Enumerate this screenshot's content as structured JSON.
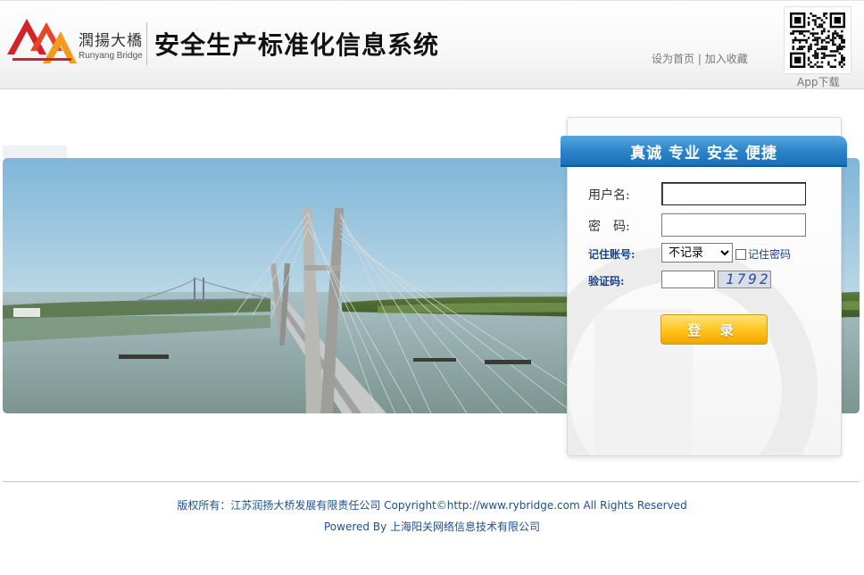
{
  "header": {
    "logo_cn": "潤揚大橋",
    "logo_en": "Runyang Bridge",
    "site_title": "安全生产标准化信息系统",
    "link_set_home": "设为首页",
    "link_separator": "|",
    "link_bookmark": "加入收藏",
    "app_download": "App下载"
  },
  "colors": {
    "logo_red": "#d3232a",
    "logo_orange": "#f29c1f",
    "slogan_blue": "#2b83c9",
    "login_button": "#ffc31a",
    "footer_text": "#1e4f8f"
  },
  "login": {
    "slogan": "真诚 专业 安全 便捷",
    "username_label": "用户名:",
    "username_value": "",
    "password_label": "密　码:",
    "password_value": "",
    "remember_account_label": "记住账号:",
    "remember_options": [
      "不记录"
    ],
    "remember_selected": "不记录",
    "remember_password_label": "记住密码",
    "captcha_label": "验证码:",
    "captcha_value": "",
    "captcha_code": "1792",
    "login_button": "登 录"
  },
  "footer": {
    "line1": "版权所有：江苏润扬大桥发展有限责任公司 Copyright©http://www.rybridge.com All Rights Reserved",
    "line2": "Powered By 上海阳关网络信息技术有限公司"
  },
  "icons": [
    "runyang-logo-icon",
    "qr-code-icon",
    "chevron-down-icon",
    "checkbox-icon"
  ]
}
